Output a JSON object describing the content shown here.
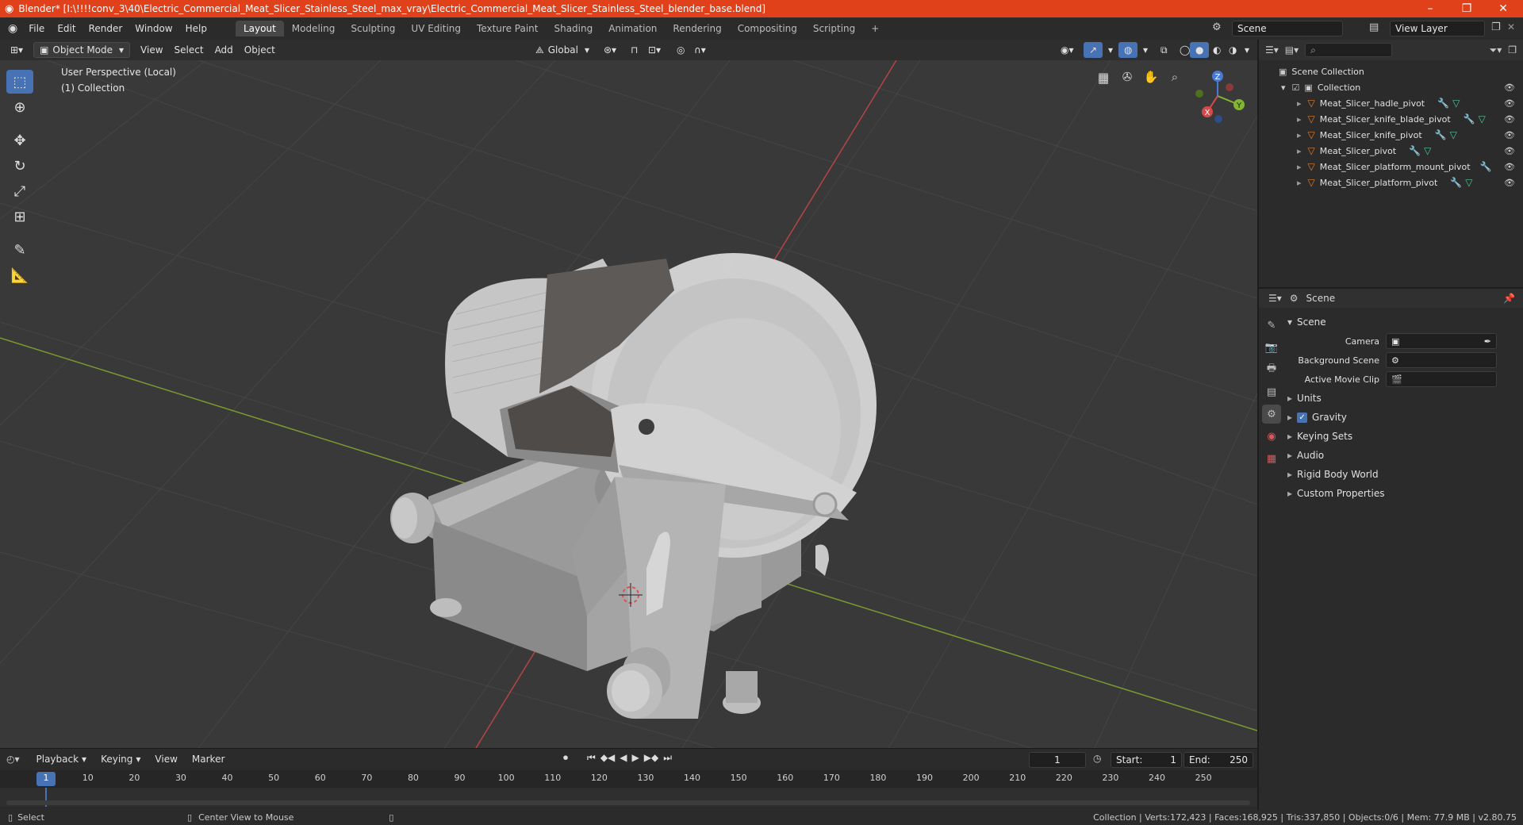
{
  "window": {
    "title": "Blender* [I:\\!!!!conv_3\\40\\Electric_Commercial_Meat_Slicer_Stainless_Steel_max_vray\\Electric_Commercial_Meat_Slicer_Stainless_Steel_blender_base.blend]",
    "minimize": "–",
    "restore": "❐",
    "close": "✕"
  },
  "menu": [
    "File",
    "Edit",
    "Render",
    "Window",
    "Help"
  ],
  "workspaces": [
    "Layout",
    "Modeling",
    "Sculpting",
    "UV Editing",
    "Texture Paint",
    "Shading",
    "Animation",
    "Rendering",
    "Compositing",
    "Scripting"
  ],
  "workspace_add": "+",
  "scene_field": "Scene",
  "view_layer_field": "View Layer",
  "viewport_header": {
    "mode": "Object Mode",
    "view": "View",
    "select": "Select",
    "add": "Add",
    "object": "Object",
    "orientation": "Global"
  },
  "viewport": {
    "perspective": "User Perspective (Local)",
    "collection": "(1) Collection"
  },
  "gizmo": {
    "x": "X",
    "y": "Y",
    "z": "Z"
  },
  "outliner": {
    "root": "Scene Collection",
    "collection": "Collection",
    "items": [
      "Meat_Slicer_hadle_pivot",
      "Meat_Slicer_knife_blade_pivot",
      "Meat_Slicer_knife_pivot",
      "Meat_Slicer_pivot",
      "Meat_Slicer_platform_mount_pivot",
      "Meat_Slicer_platform_pivot"
    ]
  },
  "properties": {
    "header": "Scene",
    "section": "Scene",
    "camera_label": "Camera",
    "background_label": "Background Scene",
    "movie_clip_label": "Active Movie Clip",
    "subpanels": [
      "Units",
      "Gravity",
      "Keying Sets",
      "Audio",
      "Rigid Body World",
      "Custom Properties"
    ],
    "gravity_checked": true
  },
  "timeline": {
    "playback": "Playback",
    "keying": "Keying",
    "view": "View",
    "marker": "Marker",
    "current_frame": "1",
    "start_label": "Start:",
    "start": "1",
    "end_label": "End:",
    "end": "250",
    "ticks": [
      "1",
      "10",
      "20",
      "30",
      "40",
      "50",
      "60",
      "70",
      "80",
      "90",
      "100",
      "110",
      "120",
      "130",
      "140",
      "150",
      "160",
      "170",
      "180",
      "190",
      "200",
      "210",
      "220",
      "230",
      "240",
      "250"
    ]
  },
  "status": {
    "select": "Select",
    "center": "Center View to Mouse",
    "stats": "Collection | Verts:172,423 | Faces:168,925 | Tris:337,850 | Objects:0/6 | Mem: 77.9 MB | v2.80.75"
  },
  "colors": {
    "title_bar": "#e0411a",
    "accent_blue": "#4772b3",
    "viewport_bg": "#393939",
    "axis_x": "#c94a4a",
    "axis_y": "#8fb83a"
  }
}
